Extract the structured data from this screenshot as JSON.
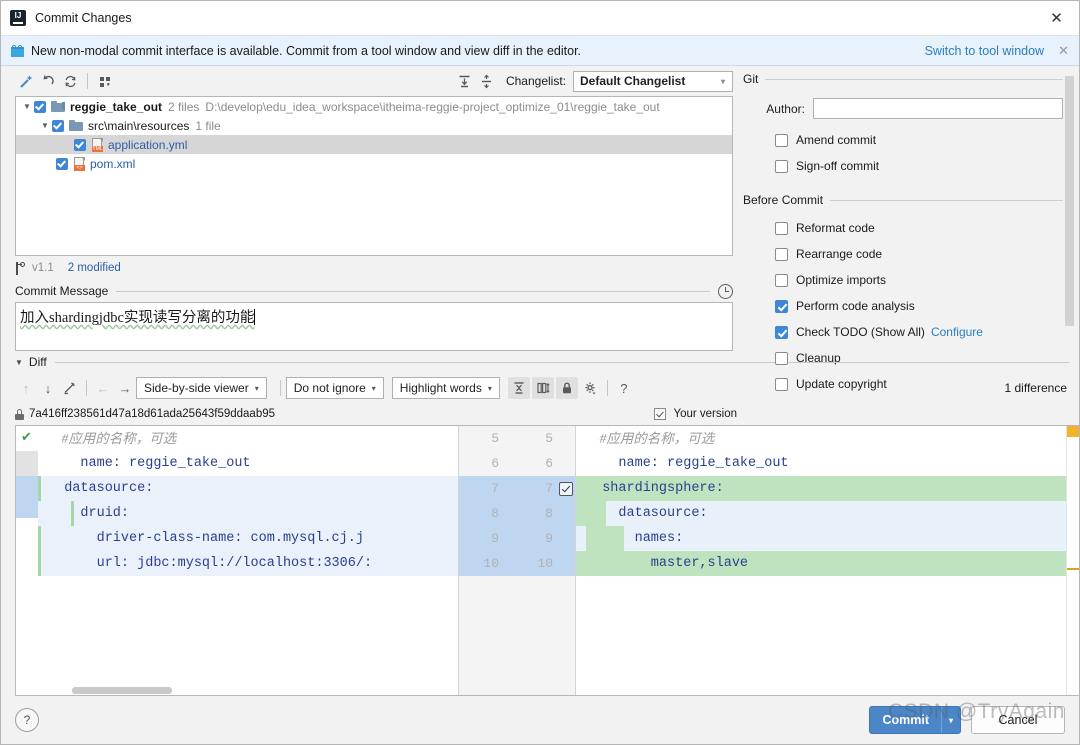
{
  "window": {
    "title": "Commit Changes",
    "app_icon": "intellij-idea-icon",
    "close_label": "✕"
  },
  "notification": {
    "icon": "gift-icon",
    "text": "New non-modal commit interface is available. Commit from a tool window and view diff in the editor.",
    "link": "Switch to tool window",
    "close": "✕"
  },
  "toolbar": {
    "icons": [
      "magic-wand-icon",
      "revert-icon",
      "refresh-icon",
      "group-by-icon",
      "expand-all-icon",
      "collapse-all-icon"
    ],
    "changelist_label": "Changelist:",
    "changelist_value": "Default Changelist",
    "dropdown_arrow": "▾"
  },
  "tree": {
    "nodes": [
      {
        "arrow": "▼",
        "name": "reggie_take_out",
        "meta": "2 files",
        "path": "D:\\develop\\edu_idea_workspace\\itheima-reggie-project_optimize_01\\reggie_take_out",
        "icon": "vcs-folder-icon",
        "checked": true,
        "selected": false
      },
      {
        "arrow": "▼",
        "name": "src\\main\\resources",
        "meta": "1 file",
        "path": "",
        "icon": "folder-icon",
        "checked": true,
        "selected": false
      },
      {
        "arrow": "",
        "name": "application.yml",
        "meta": "",
        "path": "",
        "icon": "yml-file-icon",
        "icon_tag": "YML",
        "checked": true,
        "selected": true
      },
      {
        "arrow": "",
        "name": "pom.xml",
        "meta": "",
        "path": "",
        "icon": "xml-file-icon",
        "icon_tag": "<>",
        "checked": true,
        "selected": false
      }
    ]
  },
  "status": {
    "branch_icon": "branch-icon",
    "version": "v1.1",
    "modified": "2 modified"
  },
  "commit_message": {
    "title": "Commit Message",
    "clock_icon": "history-clock-icon",
    "value": "加入shardingjdbc实现读写分离的功能"
  },
  "git_panel": {
    "group_label": "Git",
    "author_label": "Author:",
    "author_value": "",
    "options": [
      {
        "label": "Amend commit",
        "checked": false
      },
      {
        "label": "Sign-off commit",
        "checked": false
      }
    ]
  },
  "before_commit": {
    "group_label": "Before Commit",
    "options": [
      {
        "label": "Reformat code",
        "checked": false,
        "link": ""
      },
      {
        "label": "Rearrange code",
        "checked": false,
        "link": ""
      },
      {
        "label": "Optimize imports",
        "checked": false,
        "link": ""
      },
      {
        "label": "Perform code analysis",
        "checked": true,
        "link": ""
      },
      {
        "label": "Check TODO (Show All)",
        "checked": true,
        "link": "Configure"
      },
      {
        "label": "Cleanup",
        "checked": false,
        "link": ""
      },
      {
        "label": "Update copyright",
        "checked": false,
        "link": ""
      }
    ]
  },
  "diff": {
    "section_label": "Diff",
    "section_arrow": "▼",
    "nav": {
      "prev_icon": "arrow-up-icon",
      "next_icon": "arrow-down-icon",
      "edit_icon": "pencil-icon",
      "apply_left_icon": "arrow-left-icon",
      "apply_right_icon": "arrow-right-icon"
    },
    "viewer_mode": "Side-by-side viewer",
    "ignore_mode": "Do not ignore",
    "highlight_mode": "Highlight words",
    "toggles": [
      "collapse-unchanged-icon",
      "align-changes-icon",
      "lock-icon",
      "settings-gear-icon"
    ],
    "help_icon": "?",
    "difference_count": "1 difference",
    "revision_hash": "7a416ff238561d47a18d61ada25643f59ddaab95",
    "revision_lock_icon": "lock-icon",
    "your_version_label": "Your version",
    "your_version_checked": true,
    "left_lines": [
      {
        "text": "    #应用的名称，可选",
        "style": "comment",
        "bg": "plain"
      },
      {
        "text": "    name: reggie_take_out",
        "style": "code",
        "bg": "plain"
      },
      {
        "text": "  datasource:",
        "style": "code",
        "bg": "bl"
      },
      {
        "text": "    druid:",
        "style": "code",
        "bg": "bl"
      },
      {
        "text": "      driver-class-name: com.mysql.cj.j",
        "style": "code",
        "bg": "bl"
      },
      {
        "text": "      url: jdbc:mysql://localhost:3306/:",
        "style": "code",
        "bg": "bl"
      }
    ],
    "line_numbers": [
      {
        "a": "5",
        "b": "5",
        "highlight": false,
        "checkbox": false
      },
      {
        "a": "6",
        "b": "6",
        "highlight": false,
        "checkbox": false
      },
      {
        "a": "7",
        "b": "7",
        "highlight": true,
        "checkbox": true
      },
      {
        "a": "8",
        "b": "8",
        "highlight": true,
        "checkbox": false
      },
      {
        "a": "9",
        "b": "9",
        "highlight": true,
        "checkbox": false
      },
      {
        "a": "10",
        "b": "10",
        "highlight": true,
        "checkbox": false
      }
    ],
    "right_lines": [
      {
        "text": "    #应用的名称，可选",
        "style": "comment",
        "bg": "plain"
      },
      {
        "text": "    name: reggie_take_out",
        "style": "code",
        "bg": "plain"
      },
      {
        "text": "  shardingsphere:",
        "style": "code",
        "bg": "gr"
      },
      {
        "text": "    datasource:",
        "style": "code",
        "bg": "gr2"
      },
      {
        "text": "      names:",
        "style": "code",
        "bg": "gr2"
      },
      {
        "text": "        master,slave",
        "style": "code",
        "bg": "gr"
      }
    ]
  },
  "bottom": {
    "help_label": "?",
    "commit_label": "Commit",
    "commit_arrow": "▾",
    "cancel_label": "Cancel"
  },
  "watermark": "CSDN @TryAgain",
  "colors": {
    "accent": "#4a86c8",
    "link": "#2b7ec1",
    "added": "#bfe3bf",
    "modified": "#eaf1fb",
    "selection": "#bed6f0"
  }
}
